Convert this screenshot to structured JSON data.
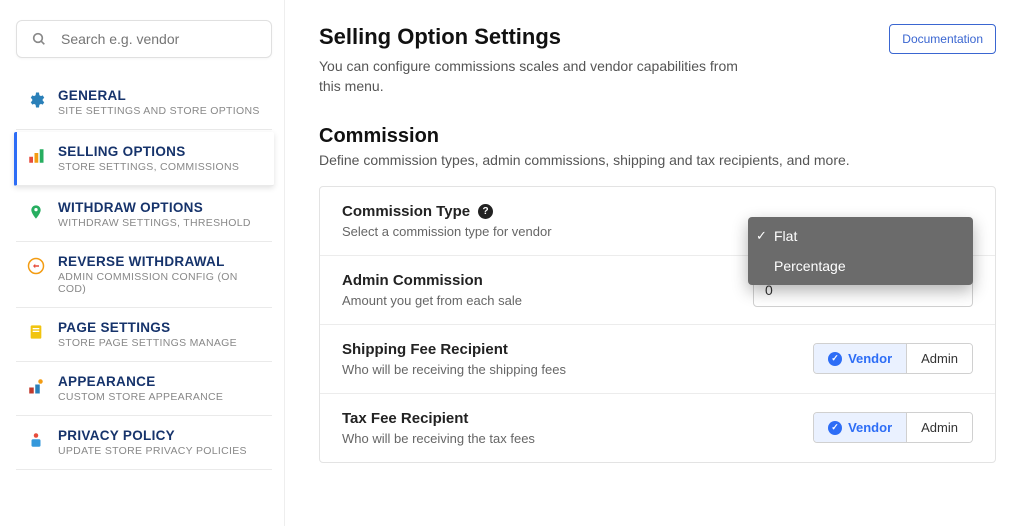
{
  "search": {
    "placeholder": "Search e.g. vendor"
  },
  "sidebar": {
    "items": [
      {
        "title": "GENERAL",
        "sub": "SITE SETTINGS AND STORE OPTIONS"
      },
      {
        "title": "SELLING OPTIONS",
        "sub": "STORE SETTINGS, COMMISSIONS"
      },
      {
        "title": "WITHDRAW OPTIONS",
        "sub": "WITHDRAW SETTINGS, THRESHOLD"
      },
      {
        "title": "REVERSE WITHDRAWAL",
        "sub": "ADMIN COMMISSION CONFIG (ON COD)"
      },
      {
        "title": "PAGE SETTINGS",
        "sub": "STORE PAGE SETTINGS MANAGE"
      },
      {
        "title": "APPEARANCE",
        "sub": "CUSTOM STORE APPEARANCE"
      },
      {
        "title": "PRIVACY POLICY",
        "sub": "UPDATE STORE PRIVACY POLICIES"
      }
    ]
  },
  "header": {
    "title": "Selling Option Settings",
    "desc": "You can configure commissions scales and vendor capabilities from this menu.",
    "doc_btn": "Documentation"
  },
  "commission": {
    "title": "Commission",
    "desc": "Define commission types, admin commissions, shipping and tax recipients, and more.",
    "rows": {
      "type": {
        "title": "Commission Type",
        "sub": "Select a commission type for vendor"
      },
      "admin": {
        "title": "Admin Commission",
        "sub": "Amount you get from each sale",
        "value": "0"
      },
      "ship": {
        "title": "Shipping Fee Recipient",
        "sub": "Who will be receiving the shipping fees"
      },
      "tax": {
        "title": "Tax Fee Recipient",
        "sub": "Who will be receiving the tax fees"
      }
    },
    "dropdown": {
      "flat": "Flat",
      "percentage": "Percentage"
    },
    "toggle": {
      "vendor": "Vendor",
      "admin": "Admin"
    }
  }
}
